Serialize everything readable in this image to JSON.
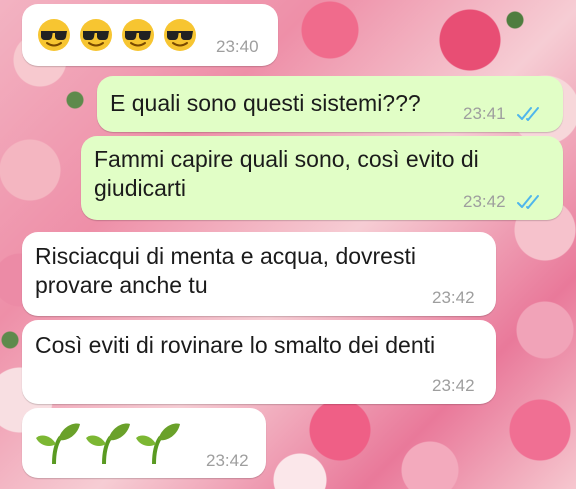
{
  "messages": [
    {
      "id": "m1",
      "direction": "incoming",
      "type": "emoji",
      "icon": "sunglasses-face-icon",
      "text": "😎😎😎😎",
      "time": "23:40"
    },
    {
      "id": "m2",
      "direction": "outgoing",
      "type": "text",
      "lines": [
        "E quali sono questi sistemi???"
      ],
      "time": "23:41",
      "status": "read"
    },
    {
      "id": "m3",
      "direction": "outgoing",
      "type": "text",
      "lines": [
        "Fammi capire quali sono, così evito di",
        "giudicarti"
      ],
      "time": "23:42",
      "status": "read"
    },
    {
      "id": "m4",
      "direction": "incoming",
      "type": "text",
      "lines": [
        "Risciacqui di menta e acqua, dovresti",
        "provare anche tu"
      ],
      "time": "23:42"
    },
    {
      "id": "m5",
      "direction": "incoming",
      "type": "text",
      "lines": [
        "Così eviti di rovinare lo smalto dei denti"
      ],
      "time": "23:42"
    },
    {
      "id": "m6",
      "direction": "incoming",
      "type": "emoji",
      "icon": "seedling-icon",
      "text": "🌱🌱🌱",
      "time": "23:42"
    }
  ],
  "colors": {
    "incoming_bubble": "#ffffff",
    "outgoing_bubble": "#e1fec6",
    "read_ticks": "#4fb6ec",
    "timestamp": "#9e9e9e",
    "seedling": "#6aa12a",
    "sunglasses_face": "#f7c531"
  }
}
